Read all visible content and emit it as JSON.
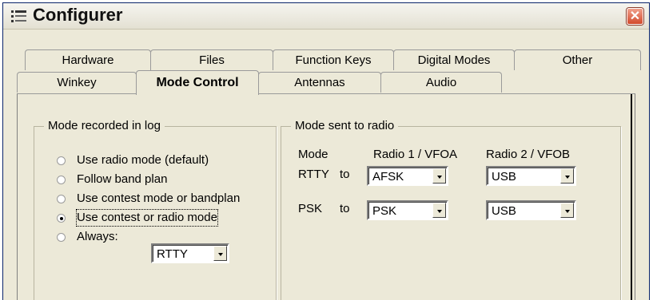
{
  "window": {
    "title": "Configurer"
  },
  "tabs_back": [
    "Hardware",
    "Files",
    "Function Keys",
    "Digital Modes",
    "Other"
  ],
  "tabs_front": [
    "Winkey",
    "Mode Control",
    "Antennas",
    "Audio"
  ],
  "active_tab": "Mode Control",
  "mode_log": {
    "legend": "Mode recorded in log",
    "options": [
      "Use radio mode (default)",
      "Follow band plan",
      "Use contest mode or bandplan",
      "Use contest or radio mode",
      "Always:"
    ],
    "selected": "Use contest or radio mode",
    "always_value": "RTTY"
  },
  "mode_radio": {
    "legend": "Mode sent to radio",
    "headers": {
      "mode": "Mode",
      "radio1": "Radio 1 / VFOA",
      "radio2": "Radio 2 / VFOB"
    },
    "rows": [
      {
        "label": "RTTY",
        "to": "to",
        "radio1": "AFSK",
        "radio2": "USB"
      },
      {
        "label": "PSK",
        "to": "to",
        "radio1": "PSK",
        "radio2": "USB"
      }
    ]
  }
}
